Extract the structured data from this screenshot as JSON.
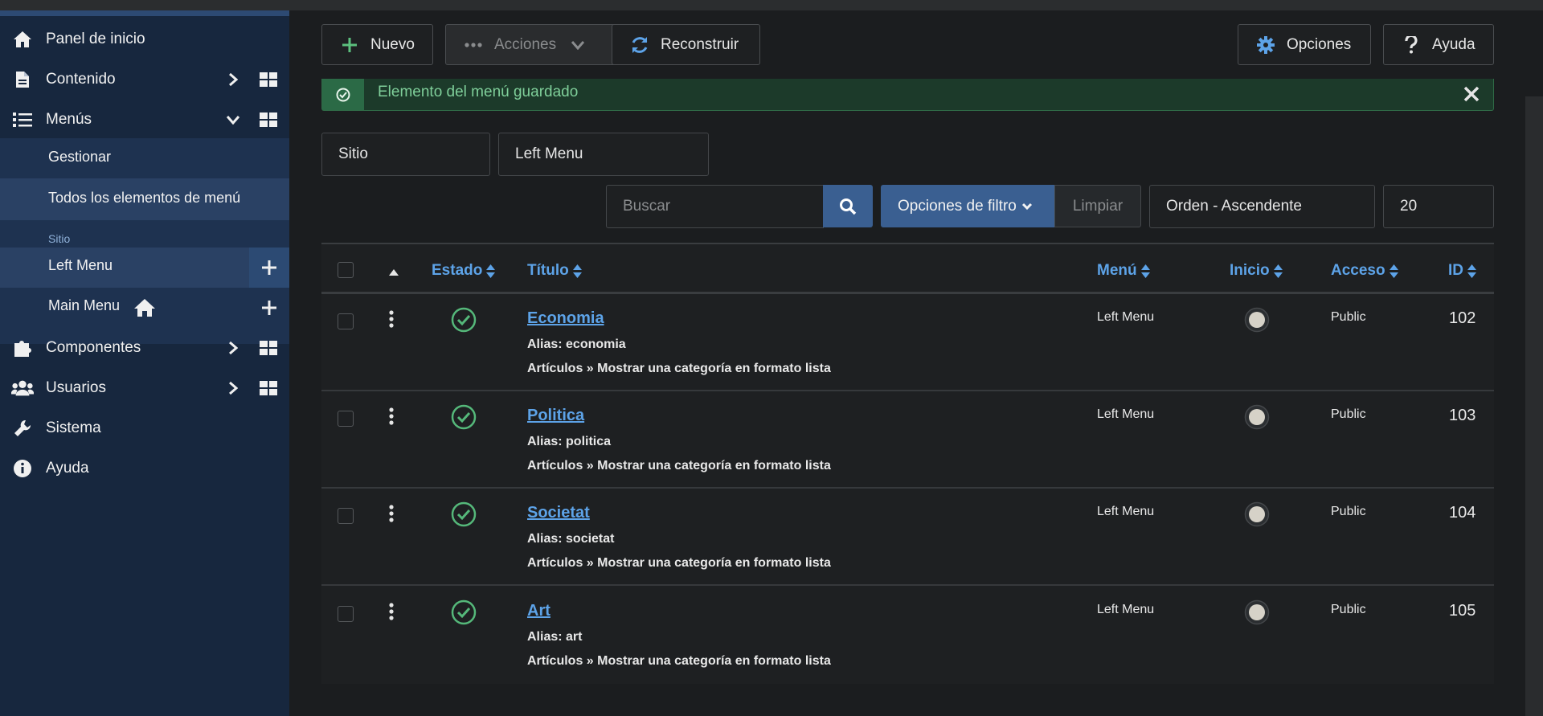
{
  "sidebar": {
    "items": [
      {
        "label": "Panel de inicio",
        "icon": "home-icon"
      },
      {
        "label": "Contenido",
        "icon": "file-icon"
      },
      {
        "label": "Menús",
        "icon": "list-icon"
      },
      {
        "label": "Componentes",
        "icon": "puzzle-icon"
      },
      {
        "label": "Usuarios",
        "icon": "users-icon"
      },
      {
        "label": "Sistema",
        "icon": "wrench-icon"
      },
      {
        "label": "Ayuda",
        "icon": "info-icon"
      }
    ],
    "submenu": {
      "manage": "Gestionar",
      "all_items": "Todos los elementos de menú",
      "heading": "Sitio",
      "left_menu": "Left Menu",
      "main_menu": "Main Menu"
    }
  },
  "toolbar": {
    "new": "Nuevo",
    "actions": "Acciones",
    "rebuild": "Reconstruir",
    "options": "Opciones",
    "help": "Ayuda"
  },
  "alert": {
    "message": "Elemento del menú guardado"
  },
  "filters": {
    "client": "Sitio",
    "menu": "Left Menu",
    "search_placeholder": "Buscar",
    "filter_options": "Opciones de filtro",
    "clear": "Limpiar",
    "ordering": "Orden - Ascendente",
    "limit": "20"
  },
  "table": {
    "headers": {
      "status": "Estado",
      "title": "Título",
      "menu": "Menú",
      "home": "Inicio",
      "access": "Acceso",
      "id": "ID"
    },
    "rows": [
      {
        "title": "Economia",
        "alias": "Alias: economia",
        "type": "Artículos » Mostrar una categoría en formato lista",
        "menu": "Left Menu",
        "access": "Public",
        "id": "102"
      },
      {
        "title": "Politica",
        "alias": "Alias: politica",
        "type": "Artículos » Mostrar una categoría en formato lista",
        "menu": "Left Menu",
        "access": "Public",
        "id": "103"
      },
      {
        "title": "Societat",
        "alias": "Alias: societat",
        "type": "Artículos » Mostrar una categoría en formato lista",
        "menu": "Left Menu",
        "access": "Public",
        "id": "104"
      },
      {
        "title": "Art",
        "alias": "Alias: art",
        "type": "Artículos » Mostrar una categoría en formato lista",
        "menu": "Left Menu",
        "access": "Public",
        "id": "105"
      }
    ]
  },
  "colors": {
    "accent": "#5da3e8",
    "success": "#55b87a",
    "sidebar": "#17273e"
  }
}
